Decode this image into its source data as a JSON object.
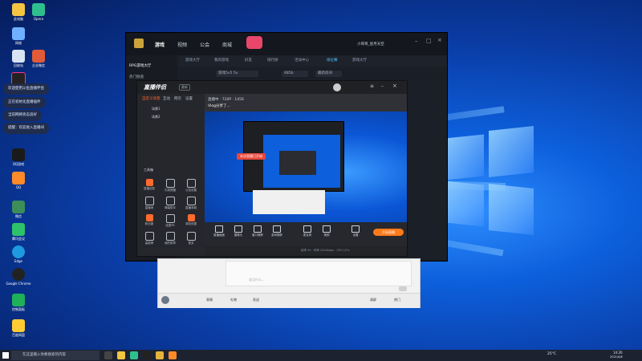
{
  "desktop": {
    "icons": [
      "此电脑",
      "网络",
      "回收站",
      "Tencent",
      "QQ游戏",
      "QQ",
      "微信",
      "腾讯会议",
      "Edge",
      "Google Chrome",
      "控制面板",
      "企业微信",
      "微信",
      "百度网盘",
      "Opera"
    ]
  },
  "notifications": [
    "欢迎使用斗鱼直播伴侣",
    "正在初始化直播插件",
    "当前网络状态良好",
    "提醒：欢迎进入直播间"
  ],
  "game_window": {
    "nav": [
      "游戏",
      "视频",
      "公会",
      "商城"
    ],
    "subnav": [
      "游戏大厅",
      "我的游戏",
      "好友",
      "排行榜",
      "活动中心",
      "排位赛",
      "游戏大厅"
    ],
    "sidebar_header": "RPG游戏大厅",
    "sidebar_item": "热门频道",
    "filter": [
      "游戏5v5 5v",
      "485b",
      "最新房间"
    ],
    "user": "小哥哥_星月天空"
  },
  "live_window": {
    "brand": "直播伴侣",
    "version": "最新",
    "tabs": [
      "自定义场景",
      "互动",
      "网页",
      "设置"
    ],
    "scene_items": [
      "场景1",
      "场景2"
    ],
    "tool_header": "工具箱",
    "tools": [
      "直播回放",
      "礼物提醒",
      "公告设置",
      "直播间",
      "弹幕助手",
      "直播商城",
      "粉丝团",
      "连麦PK",
      "录制设置",
      "高能榜",
      "我的勋章",
      "更多"
    ],
    "stream_info": "直播中 · 720P · 1456",
    "stream_title": "Vlog分享了...",
    "toolbar": [
      "直播画面",
      "摄像头",
      "窗口捕获",
      "游戏捕获",
      "麦克风",
      "美颜",
      "设置"
    ],
    "start_button": "开始直播",
    "status_bar": "帧率 30 · 码率 2500kbps · CPU 12%",
    "side_notice": "本次直播已开始"
  },
  "chat_window": {
    "placeholder": "说点什么...",
    "bar": [
      "表情",
      "礼物",
      "发送",
      "清屏",
      "热门"
    ],
    "send_label": "发送"
  },
  "taskbar": {
    "search_placeholder": "在这里输入你要搜索的内容",
    "weather": "25°C",
    "time": "14:20",
    "date": "2021/6/8"
  },
  "colors": {
    "accent_orange": "#ff7a1a",
    "accent_blue": "#4cc3ff",
    "desktop_blue": "#0d5fdc"
  }
}
